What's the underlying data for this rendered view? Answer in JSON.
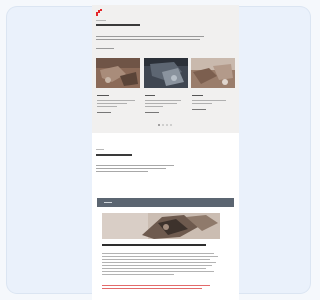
{
  "brand": {
    "logo_icon": "brand-logo-icon",
    "accent": "#e42528"
  },
  "hero": {
    "eyebrow": "",
    "title": "",
    "intro": "",
    "link": ""
  },
  "cards": [
    {
      "title": "",
      "text": "",
      "link": ""
    },
    {
      "title": "",
      "text": "",
      "link": ""
    },
    {
      "title": "",
      "text": "",
      "link": ""
    }
  ],
  "carousel": {
    "pages": 4,
    "active": 1
  },
  "section": {
    "eyebrow": "",
    "title": "",
    "text": ""
  },
  "feature": {
    "bar_label": "",
    "title": "",
    "body": "",
    "warning": "",
    "cta": ""
  }
}
